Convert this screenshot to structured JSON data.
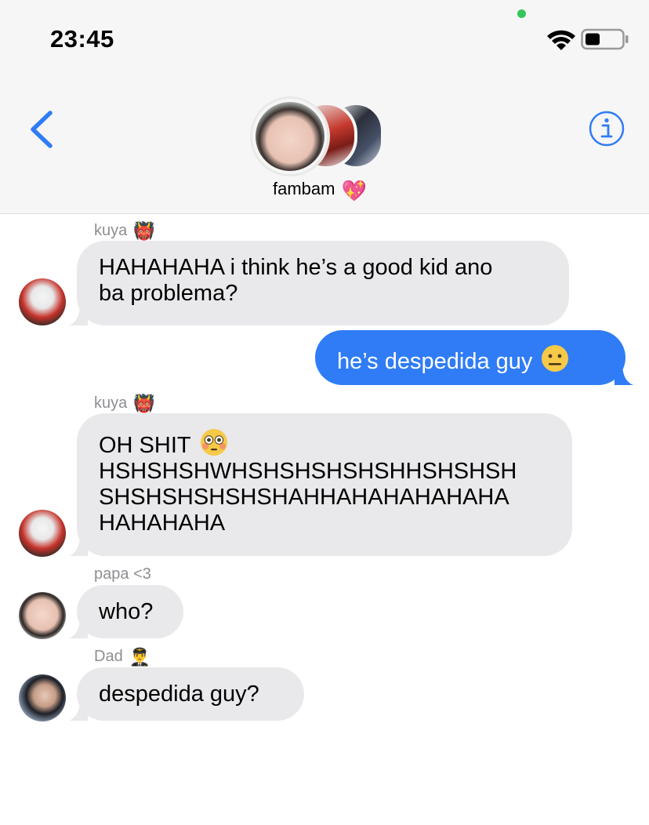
{
  "status_bar": {
    "time": "23:45"
  },
  "header": {
    "group_name": "fambam",
    "group_emoji": "💖"
  },
  "colors": {
    "accent": "#2f7cf6",
    "incoming_bubble": "#e9e9eb",
    "header_bg": "#f6f6f6",
    "sender_label": "#8e8e93"
  },
  "icons": {
    "back": "chevron-left-icon",
    "info": "info-icon",
    "wifi": "wifi-icon",
    "battery": "battery-icon"
  },
  "messages": [
    {
      "sender": "kuya",
      "sender_emoji": "👹",
      "direction": "incoming",
      "lines": [
        "HAHAHAHA i think he’s a good kid ano",
        "ba problema?"
      ]
    },
    {
      "direction": "outgoing",
      "lines": [
        "he’s despedida guy"
      ],
      "emoji": "😐"
    },
    {
      "sender": "kuya",
      "sender_emoji": "👹",
      "direction": "incoming",
      "lines": [
        "OH SHIT",
        "HSHSHSHWHSHSHSHSHSHHSHSHSH",
        "SHSHSHSHSHSHAHHAHAHAHAHAHA",
        "HAHAHAHA"
      ],
      "emoji": "😳"
    },
    {
      "sender": "papa <3",
      "direction": "incoming",
      "lines": [
        "who?"
      ]
    },
    {
      "sender": "Dad",
      "sender_emoji": "👨‍✈️",
      "direction": "incoming",
      "lines": [
        "despedida guy?"
      ]
    }
  ]
}
